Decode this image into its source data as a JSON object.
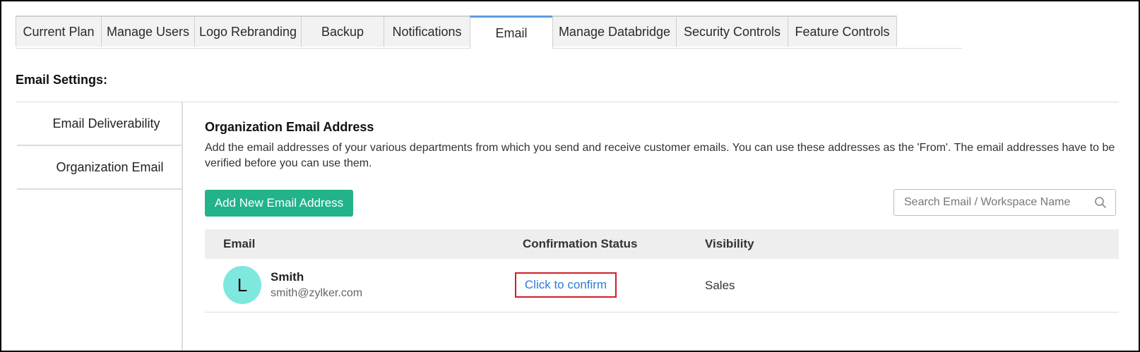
{
  "tabs": [
    {
      "label": "Current Plan",
      "active": false
    },
    {
      "label": "Manage Users",
      "active": false
    },
    {
      "label": "Logo Rebranding",
      "active": false
    },
    {
      "label": "Backup",
      "active": false
    },
    {
      "label": "Notifications",
      "active": false
    },
    {
      "label": "Email",
      "active": true
    },
    {
      "label": "Manage Databridge",
      "active": false
    },
    {
      "label": "Security Controls",
      "active": false
    },
    {
      "label": "Feature Controls",
      "active": false
    }
  ],
  "settings_title": "Email Settings:",
  "sidenav": {
    "items": [
      {
        "label": "Email Deliverability",
        "active": false
      },
      {
        "label": "Organization Email",
        "active": true
      }
    ]
  },
  "main": {
    "title": "Organization Email Address",
    "description": "Add the email addresses of your various departments from which you send and receive customer emails. You can use these addresses as the 'From'. The email addresses have to be verified before you can use them.",
    "add_button": "Add New Email Address",
    "search_placeholder": "Search Email / Workspace Name"
  },
  "table": {
    "headers": {
      "email": "Email",
      "status": "Confirmation Status",
      "visibility": "Visibility"
    },
    "rows": [
      {
        "avatar_letter": "L",
        "name": "Smith",
        "email": "smith@zylker.com",
        "status_link": "Click to confirm",
        "visibility": "Sales"
      }
    ]
  },
  "colors": {
    "accent": "#22b38b",
    "active_tab_border": "#5e9ddf",
    "highlight_box": "#d01e26",
    "link": "#2e7bd6",
    "avatar_bg": "#7ee8df"
  }
}
